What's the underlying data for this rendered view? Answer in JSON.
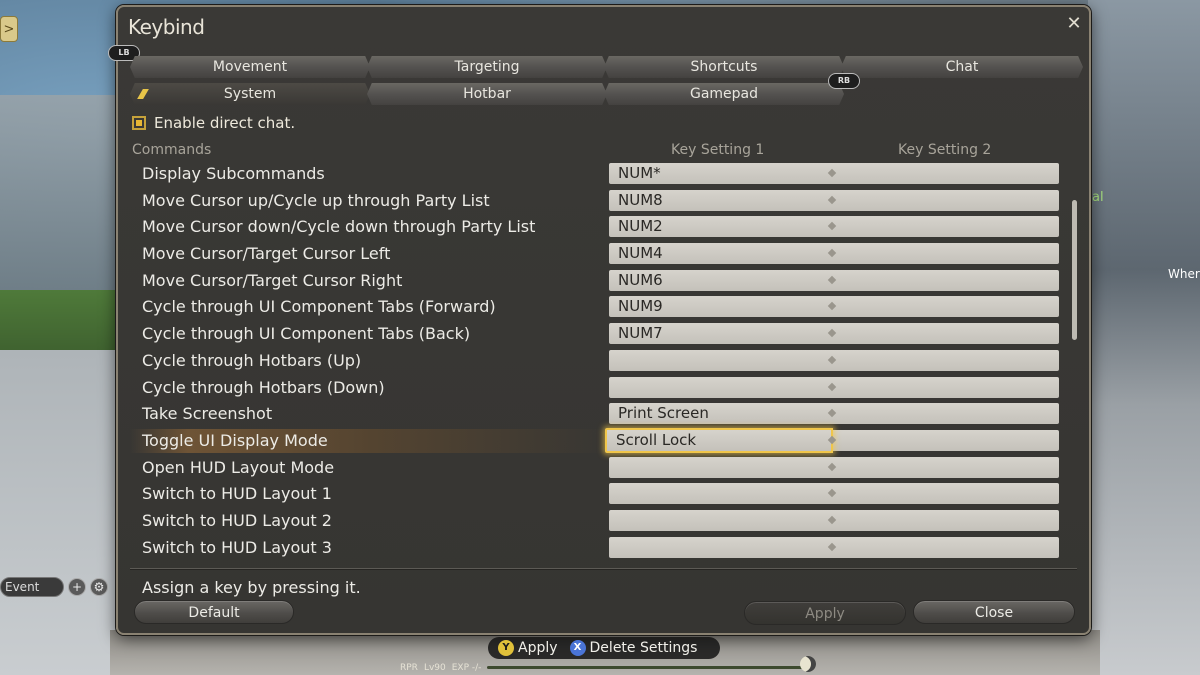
{
  "window": {
    "title": "Keybind"
  },
  "badges": {
    "lb": "LB",
    "rb": "RB"
  },
  "tabs_row1": [
    "Movement",
    "Targeting",
    "Shortcuts",
    "Chat"
  ],
  "tabs_row2": [
    "System",
    "Hotbar",
    "Gamepad"
  ],
  "active_tab": "System",
  "enable_direct_chat": {
    "label": "Enable direct chat.",
    "checked": true
  },
  "columns": {
    "commands": "Commands",
    "key1": "Key Setting 1",
    "key2": "Key Setting 2"
  },
  "rows": [
    {
      "command": "Display Subcommands",
      "key1": "NUM*",
      "key2": ""
    },
    {
      "command": "Move Cursor up/Cycle up through Party List",
      "key1": "NUM8",
      "key2": ""
    },
    {
      "command": "Move Cursor down/Cycle down through Party List",
      "key1": "NUM2",
      "key2": ""
    },
    {
      "command": "Move Cursor/Target Cursor Left",
      "key1": "NUM4",
      "key2": ""
    },
    {
      "command": "Move Cursor/Target Cursor Right",
      "key1": "NUM6",
      "key2": ""
    },
    {
      "command": "Cycle through UI Component Tabs (Forward)",
      "key1": "NUM9",
      "key2": ""
    },
    {
      "command": "Cycle through UI Component Tabs (Back)",
      "key1": "NUM7",
      "key2": ""
    },
    {
      "command": "Cycle through Hotbars (Up)",
      "key1": "",
      "key2": ""
    },
    {
      "command": "Cycle through Hotbars (Down)",
      "key1": "",
      "key2": ""
    },
    {
      "command": "Take Screenshot",
      "key1": "Print Screen",
      "key2": ""
    },
    {
      "command": "Toggle UI Display Mode",
      "key1": "Scroll Lock",
      "key2": ""
    },
    {
      "command": "Open HUD Layout Mode",
      "key1": "",
      "key2": ""
    },
    {
      "command": "Switch to HUD Layout 1",
      "key1": "",
      "key2": ""
    },
    {
      "command": "Switch to HUD Layout 2",
      "key1": "",
      "key2": ""
    },
    {
      "command": "Switch to HUD Layout 3",
      "key1": "",
      "key2": ""
    }
  ],
  "selected_row": "Toggle UI Display Mode",
  "hint": "Assign a key by pressing it.",
  "buttons": {
    "default": "Default",
    "apply": "Apply",
    "close": "Close"
  },
  "bottom_bar": {
    "y_glyph": "Y",
    "y_label": "Apply",
    "x_glyph": "X",
    "x_label": "Delete Settings"
  },
  "status": {
    "job": "RPR",
    "level": "Lv90",
    "exp": "EXP -/-"
  },
  "hud_left": {
    "event": "Event",
    "plus": "+",
    "gear": "⚙"
  },
  "hud_right": {
    "label_al": "al",
    "label_wher": "Wher"
  },
  "icons": {
    "close": "✕",
    "left_corner": ">"
  }
}
